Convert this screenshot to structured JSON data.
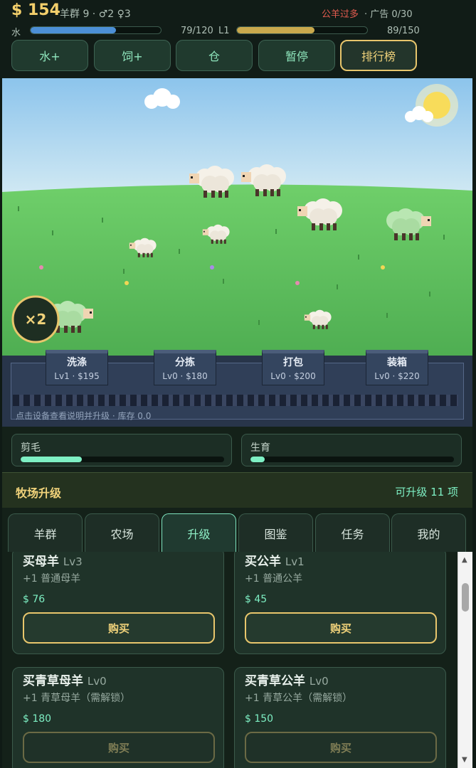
{
  "hud": {
    "money": "$ 154",
    "flock_label": "羊群 9 · ♂2 ♀3",
    "alert": "公羊过多",
    "ads": "· 广告 0/30",
    "water_label": "水",
    "water_value": "79/120",
    "water_fraction": 0.658,
    "level_label": "L1",
    "xp_value": "89/150",
    "xp_fraction": 0.593,
    "buttons": [
      "水+",
      "饲+",
      "仓",
      "暂停",
      "排行榜"
    ]
  },
  "scene": {
    "multiplier_badge": "×2"
  },
  "factory": {
    "machines": [
      {
        "name": "洗涤",
        "info": "Lv1 · $195"
      },
      {
        "name": "分拣",
        "info": "Lv0 · $180"
      },
      {
        "name": "打包",
        "info": "Lv0 · $200"
      },
      {
        "name": "装箱",
        "info": "Lv0 · $220"
      }
    ],
    "hint": "点击设备查看说明并升级 · 库存 0.0"
  },
  "progress": {
    "shearing_label": "剪毛",
    "shearing_fraction": 0.3,
    "breeding_label": "生育",
    "breeding_fraction": 0.07
  },
  "upgrade": {
    "title": "牧场升级",
    "available": "可升级 11 项"
  },
  "tabs": [
    "羊群",
    "农场",
    "升级",
    "图鉴",
    "任务",
    "我的"
  ],
  "active_tab": "升级",
  "cards": [
    {
      "title": "买母羊",
      "level": "Lv3",
      "desc": "+1 普通母羊",
      "price": "$ 76",
      "button": "购买",
      "enabled": true
    },
    {
      "title": "买公羊",
      "level": "Lv1",
      "desc": "+1 普通公羊",
      "price": "$ 45",
      "button": "购买",
      "enabled": true
    },
    {
      "title": "买青草母羊",
      "level": "Lv0",
      "desc": "+1 青草母羊（需解锁）",
      "price": "$ 180",
      "button": "购买",
      "enabled": false
    },
    {
      "title": "买青草公羊",
      "level": "Lv0",
      "desc": "+1 青草公羊（需解锁）",
      "price": "$ 150",
      "button": "购买",
      "enabled": false
    }
  ],
  "colors": {
    "accent_green": "#7ef0c4",
    "gold": "#f0d27a",
    "alert_red": "#e25b4f"
  }
}
